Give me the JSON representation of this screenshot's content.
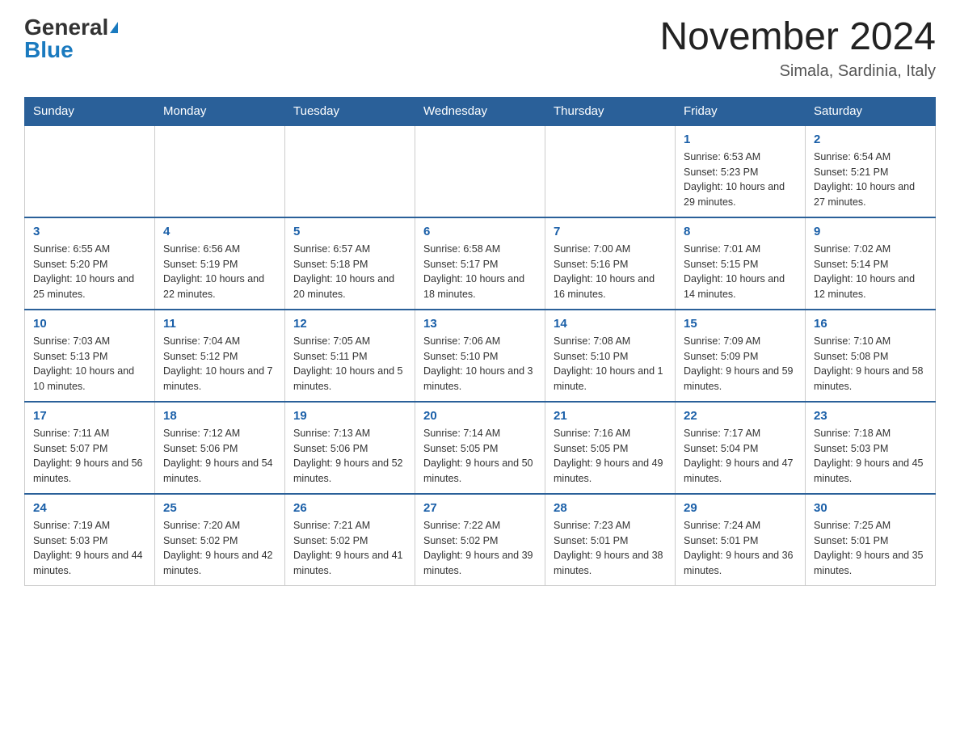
{
  "header": {
    "logo_general": "General",
    "logo_blue": "Blue",
    "month_title": "November 2024",
    "subtitle": "Simala, Sardinia, Italy"
  },
  "weekdays": [
    "Sunday",
    "Monday",
    "Tuesday",
    "Wednesday",
    "Thursday",
    "Friday",
    "Saturday"
  ],
  "weeks": [
    [
      {
        "day": "",
        "info": ""
      },
      {
        "day": "",
        "info": ""
      },
      {
        "day": "",
        "info": ""
      },
      {
        "day": "",
        "info": ""
      },
      {
        "day": "",
        "info": ""
      },
      {
        "day": "1",
        "info": "Sunrise: 6:53 AM\nSunset: 5:23 PM\nDaylight: 10 hours and 29 minutes."
      },
      {
        "day": "2",
        "info": "Sunrise: 6:54 AM\nSunset: 5:21 PM\nDaylight: 10 hours and 27 minutes."
      }
    ],
    [
      {
        "day": "3",
        "info": "Sunrise: 6:55 AM\nSunset: 5:20 PM\nDaylight: 10 hours and 25 minutes."
      },
      {
        "day": "4",
        "info": "Sunrise: 6:56 AM\nSunset: 5:19 PM\nDaylight: 10 hours and 22 minutes."
      },
      {
        "day": "5",
        "info": "Sunrise: 6:57 AM\nSunset: 5:18 PM\nDaylight: 10 hours and 20 minutes."
      },
      {
        "day": "6",
        "info": "Sunrise: 6:58 AM\nSunset: 5:17 PM\nDaylight: 10 hours and 18 minutes."
      },
      {
        "day": "7",
        "info": "Sunrise: 7:00 AM\nSunset: 5:16 PM\nDaylight: 10 hours and 16 minutes."
      },
      {
        "day": "8",
        "info": "Sunrise: 7:01 AM\nSunset: 5:15 PM\nDaylight: 10 hours and 14 minutes."
      },
      {
        "day": "9",
        "info": "Sunrise: 7:02 AM\nSunset: 5:14 PM\nDaylight: 10 hours and 12 minutes."
      }
    ],
    [
      {
        "day": "10",
        "info": "Sunrise: 7:03 AM\nSunset: 5:13 PM\nDaylight: 10 hours and 10 minutes."
      },
      {
        "day": "11",
        "info": "Sunrise: 7:04 AM\nSunset: 5:12 PM\nDaylight: 10 hours and 7 minutes."
      },
      {
        "day": "12",
        "info": "Sunrise: 7:05 AM\nSunset: 5:11 PM\nDaylight: 10 hours and 5 minutes."
      },
      {
        "day": "13",
        "info": "Sunrise: 7:06 AM\nSunset: 5:10 PM\nDaylight: 10 hours and 3 minutes."
      },
      {
        "day": "14",
        "info": "Sunrise: 7:08 AM\nSunset: 5:10 PM\nDaylight: 10 hours and 1 minute."
      },
      {
        "day": "15",
        "info": "Sunrise: 7:09 AM\nSunset: 5:09 PM\nDaylight: 9 hours and 59 minutes."
      },
      {
        "day": "16",
        "info": "Sunrise: 7:10 AM\nSunset: 5:08 PM\nDaylight: 9 hours and 58 minutes."
      }
    ],
    [
      {
        "day": "17",
        "info": "Sunrise: 7:11 AM\nSunset: 5:07 PM\nDaylight: 9 hours and 56 minutes."
      },
      {
        "day": "18",
        "info": "Sunrise: 7:12 AM\nSunset: 5:06 PM\nDaylight: 9 hours and 54 minutes."
      },
      {
        "day": "19",
        "info": "Sunrise: 7:13 AM\nSunset: 5:06 PM\nDaylight: 9 hours and 52 minutes."
      },
      {
        "day": "20",
        "info": "Sunrise: 7:14 AM\nSunset: 5:05 PM\nDaylight: 9 hours and 50 minutes."
      },
      {
        "day": "21",
        "info": "Sunrise: 7:16 AM\nSunset: 5:05 PM\nDaylight: 9 hours and 49 minutes."
      },
      {
        "day": "22",
        "info": "Sunrise: 7:17 AM\nSunset: 5:04 PM\nDaylight: 9 hours and 47 minutes."
      },
      {
        "day": "23",
        "info": "Sunrise: 7:18 AM\nSunset: 5:03 PM\nDaylight: 9 hours and 45 minutes."
      }
    ],
    [
      {
        "day": "24",
        "info": "Sunrise: 7:19 AM\nSunset: 5:03 PM\nDaylight: 9 hours and 44 minutes."
      },
      {
        "day": "25",
        "info": "Sunrise: 7:20 AM\nSunset: 5:02 PM\nDaylight: 9 hours and 42 minutes."
      },
      {
        "day": "26",
        "info": "Sunrise: 7:21 AM\nSunset: 5:02 PM\nDaylight: 9 hours and 41 minutes."
      },
      {
        "day": "27",
        "info": "Sunrise: 7:22 AM\nSunset: 5:02 PM\nDaylight: 9 hours and 39 minutes."
      },
      {
        "day": "28",
        "info": "Sunrise: 7:23 AM\nSunset: 5:01 PM\nDaylight: 9 hours and 38 minutes."
      },
      {
        "day": "29",
        "info": "Sunrise: 7:24 AM\nSunset: 5:01 PM\nDaylight: 9 hours and 36 minutes."
      },
      {
        "day": "30",
        "info": "Sunrise: 7:25 AM\nSunset: 5:01 PM\nDaylight: 9 hours and 35 minutes."
      }
    ]
  ]
}
